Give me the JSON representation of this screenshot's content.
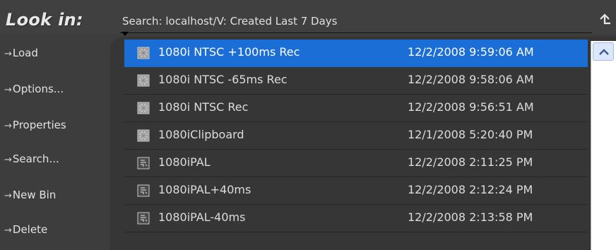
{
  "header": {
    "look_in_label": "Look in:",
    "search_text": "Search: localhost/V: Created Last 7 Days"
  },
  "commands": [
    {
      "arrow": "→",
      "label": "Load"
    },
    {
      "arrow": "→",
      "label": "Options..."
    },
    {
      "arrow": "→",
      "label": "Properties"
    },
    {
      "arrow": "→",
      "label": "Search..."
    },
    {
      "arrow": "→",
      "label": "New Bin"
    },
    {
      "arrow": "→",
      "label": "Delete"
    }
  ],
  "rows": [
    {
      "name": "1080i NTSC +100ms Rec",
      "date": "12/2/2008 9:59:06 AM",
      "icon": "clip-icon",
      "selected": true
    },
    {
      "name": "1080i NTSC -65ms Rec",
      "date": "12/2/2008 9:58:06 AM",
      "icon": "clip-icon",
      "selected": false
    },
    {
      "name": "1080i NTSC Rec",
      "date": "12/2/2008 9:56:51 AM",
      "icon": "clip-icon",
      "selected": false
    },
    {
      "name": "1080iClipboard",
      "date": "12/1/2008 5:20:40 PM",
      "icon": "clip-icon",
      "selected": false
    },
    {
      "name": "1080iPAL",
      "date": "12/2/2008 2:11:25 PM",
      "icon": "bin-icon",
      "selected": false
    },
    {
      "name": "1080iPAL+40ms",
      "date": "12/2/2008 2:12:24 PM",
      "icon": "bin-icon",
      "selected": false
    },
    {
      "name": "1080iPAL-40ms",
      "date": "12/2/2008 2:13:58 PM",
      "icon": "bin-icon",
      "selected": false
    }
  ],
  "colors": {
    "background": "#3d3d3d",
    "selection": "#1a6ed6",
    "text": "#dcdcdc"
  }
}
